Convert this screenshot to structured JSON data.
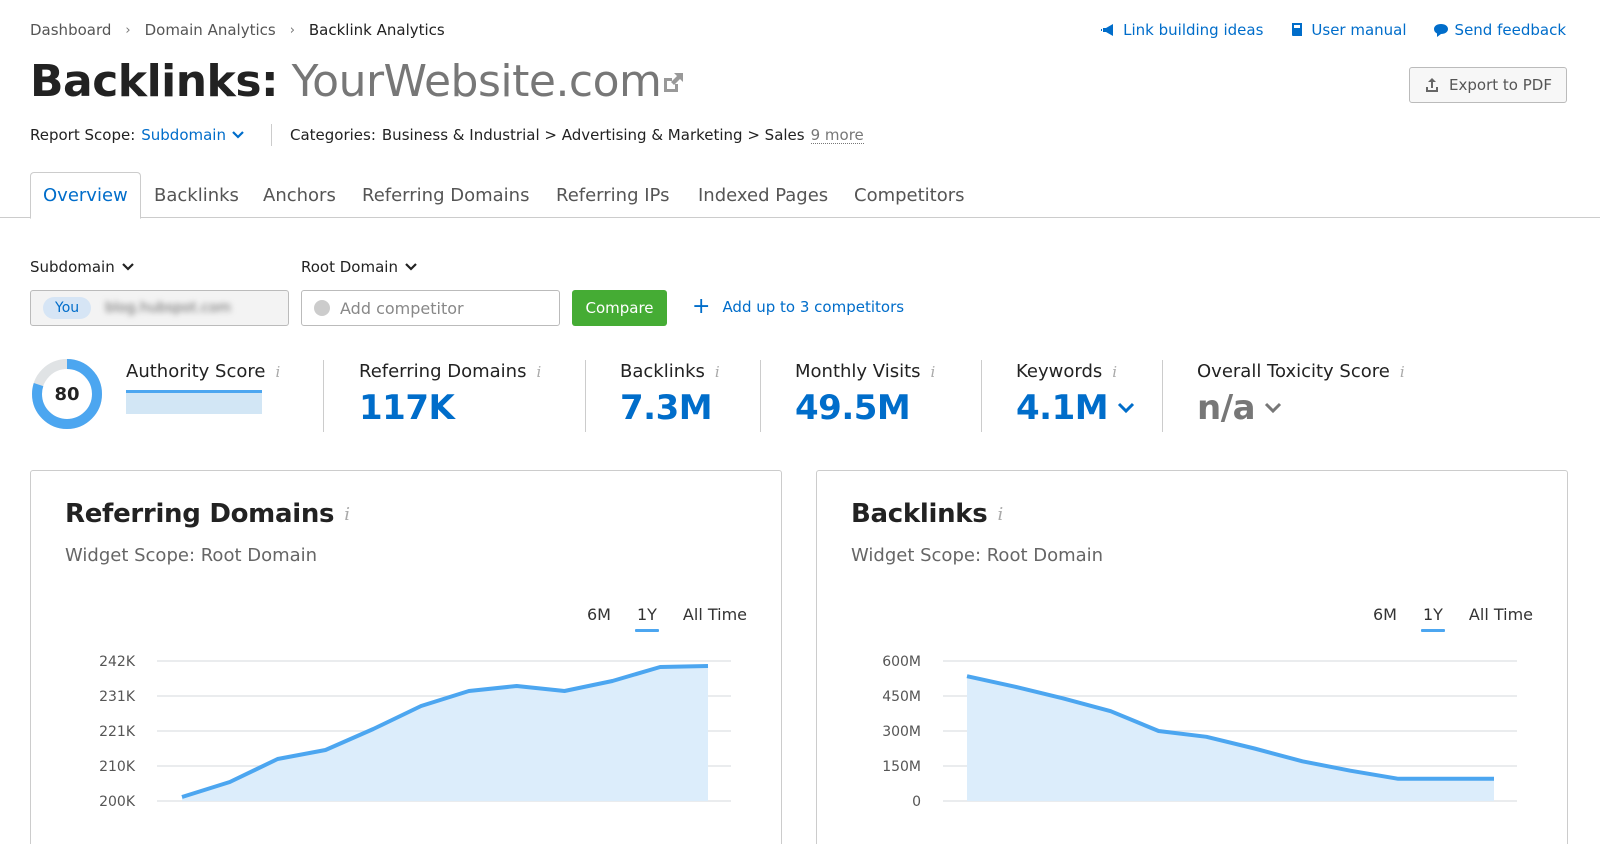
{
  "breadcrumb": [
    "Dashboard",
    "Domain Analytics",
    "Backlink Analytics"
  ],
  "top_links": {
    "link_building": "Link building ideas",
    "user_manual": "User manual",
    "send_feedback": "Send feedback"
  },
  "title": {
    "prefix": "Backlinks:",
    "domain": "YourWebsite.com"
  },
  "export_label": "Export to PDF",
  "scope": {
    "label": "Report Scope:",
    "value": "Subdomain",
    "categories_label": "Categories:",
    "categories": "Business & Industrial > Advertising & Marketing > Sales",
    "more": "9 more"
  },
  "tabs": [
    "Overview",
    "Backlinks",
    "Anchors",
    "Referring Domains",
    "Referring IPs",
    "Indexed Pages",
    "Competitors"
  ],
  "compare": {
    "you_selector": "Subdomain",
    "competitor_selector": "Root Domain",
    "you_badge": "You",
    "you_domain": "blog.hubspot.com",
    "competitor_placeholder": "Add competitor",
    "compare_button": "Compare",
    "add_more": "Add up to 3 competitors"
  },
  "metrics": {
    "authority": {
      "label": "Authority Score",
      "value": "80",
      "score_fraction": 0.8
    },
    "referring_domains": {
      "label": "Referring Domains",
      "value": "117K"
    },
    "backlinks": {
      "label": "Backlinks",
      "value": "7.3M"
    },
    "monthly_visits": {
      "label": "Monthly Visits",
      "value": "49.5M"
    },
    "keywords": {
      "label": "Keywords",
      "value": "4.1M"
    },
    "toxicity": {
      "label": "Overall Toxicity Score",
      "value": "n/a"
    }
  },
  "colors": {
    "accent": "#006dca",
    "line": "#4ca6f0",
    "fill": "#dcedfb",
    "compare_green": "#45ac34"
  },
  "chart_data": [
    {
      "type": "area",
      "title": "Referring Domains",
      "subtitle": "Widget Scope: Root Domain",
      "ranges": [
        "6M",
        "1Y",
        "All Time"
      ],
      "active_range": "1Y",
      "ytick_labels": [
        "242K",
        "231K",
        "221K",
        "210K",
        "200K"
      ],
      "ylim": [
        200000,
        242000
      ],
      "values": [
        201200,
        205700,
        212600,
        215300,
        221600,
        228500,
        233000,
        234500,
        233000,
        236000,
        240200,
        240500
      ],
      "grid": true
    },
    {
      "type": "area",
      "title": "Backlinks",
      "subtitle": "Widget Scope: Root Domain",
      "ranges": [
        "6M",
        "1Y",
        "All Time"
      ],
      "active_range": "1Y",
      "ytick_labels": [
        "600M",
        "450M",
        "300M",
        "150M",
        "0"
      ],
      "ylim": [
        0,
        600000000
      ],
      "values": [
        535000000,
        490000000,
        440000000,
        385000000,
        300000000,
        275000000,
        225000000,
        170000000,
        130000000,
        95000000,
        95000000,
        95000000
      ],
      "grid": true
    }
  ]
}
